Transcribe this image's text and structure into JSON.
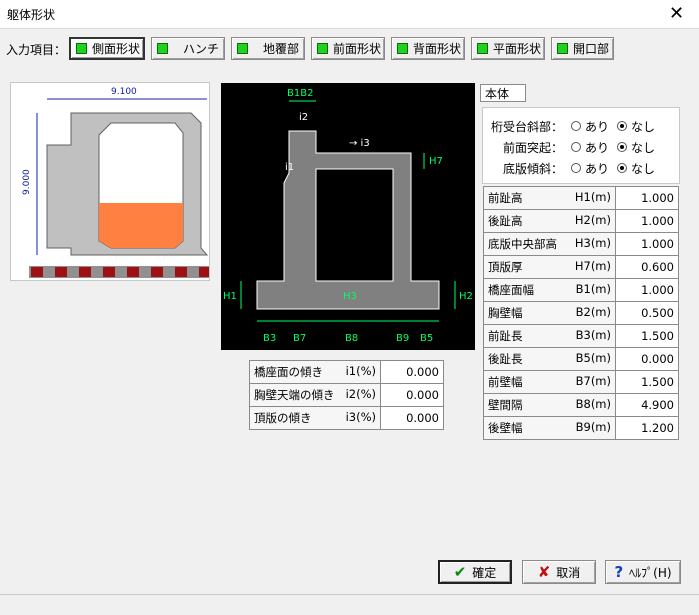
{
  "window": {
    "title": "躯体形状",
    "close_glyph": "✕"
  },
  "toolbar": {
    "label": "入力項目：",
    "buttons": [
      {
        "label": "側面形状",
        "active": true
      },
      {
        "label": "ハンチ"
      },
      {
        "label": "地覆部"
      },
      {
        "label": "前面形状"
      },
      {
        "label": "背面形状"
      },
      {
        "label": "平面形状"
      },
      {
        "label": "開口部"
      }
    ]
  },
  "preview": {
    "width_dim": "9.100",
    "height_dim": "9.000",
    "colors": {
      "concrete": "#c0c0c0",
      "fill": "#ff8040",
      "ground_red": "#a01010",
      "ground_gray": "#909090",
      "dim": "#1020a0"
    }
  },
  "diagram": {
    "labels": {
      "b1b2": "B1B2",
      "i2": "i2",
      "i3": "→ i3",
      "i1": "i1",
      "h7": "H7",
      "h1": "H1",
      "h2": "H2",
      "h3": "H3",
      "b3": "B3",
      "b7": "B7",
      "b8": "B8",
      "b9": "B9",
      "b5": "B5"
    },
    "colors": {
      "body": "#808080",
      "line": "#ffffff",
      "dim": "#00ff66"
    }
  },
  "slopes": {
    "rows": [
      {
        "label": "橋座面の傾き",
        "unit": "i1(%)",
        "value": "0.000"
      },
      {
        "label": "胸壁天端の傾き",
        "unit": "i2(%)",
        "value": "0.000"
      },
      {
        "label": "頂版の傾き",
        "unit": "i3(%)",
        "value": "0.000"
      }
    ]
  },
  "section_tab": "本体",
  "options": {
    "rows": [
      {
        "label": "桁受台斜部：",
        "opt1": "あり",
        "opt2": "なし",
        "selected": 2
      },
      {
        "label": "前面突起：",
        "opt1": "あり",
        "opt2": "なし",
        "selected": 2
      },
      {
        "label": "底版傾斜：",
        "opt1": "あり",
        "opt2": "なし",
        "selected": 2
      }
    ]
  },
  "dimensions": {
    "rows": [
      {
        "label": "前趾高",
        "unit": "H1(m)",
        "value": "1.000"
      },
      {
        "label": "後趾高",
        "unit": "H2(m)",
        "value": "1.000"
      },
      {
        "label": "底版中央部高",
        "unit": "H3(m)",
        "value": "1.000"
      },
      {
        "label": "頂版厚",
        "unit": "H7(m)",
        "value": "0.600"
      },
      {
        "label": "橋座面幅",
        "unit": "B1(m)",
        "value": "1.000"
      },
      {
        "label": "胸壁幅",
        "unit": "B2(m)",
        "value": "0.500"
      },
      {
        "label": "前趾長",
        "unit": "B3(m)",
        "value": "1.500"
      },
      {
        "label": "後趾長",
        "unit": "B5(m)",
        "value": "0.000"
      },
      {
        "label": "前壁幅",
        "unit": "B7(m)",
        "value": "1.500"
      },
      {
        "label": "壁間隔",
        "unit": "B8(m)",
        "value": "4.900"
      },
      {
        "label": "後壁幅",
        "unit": "B9(m)",
        "value": "1.200"
      }
    ]
  },
  "footer": {
    "ok": {
      "icon": "✔",
      "label": "確定"
    },
    "cancel": {
      "icon": "✘",
      "label": "取消"
    },
    "help": {
      "icon": "?",
      "label": "ﾍﾙﾌﾟ(H)"
    }
  }
}
